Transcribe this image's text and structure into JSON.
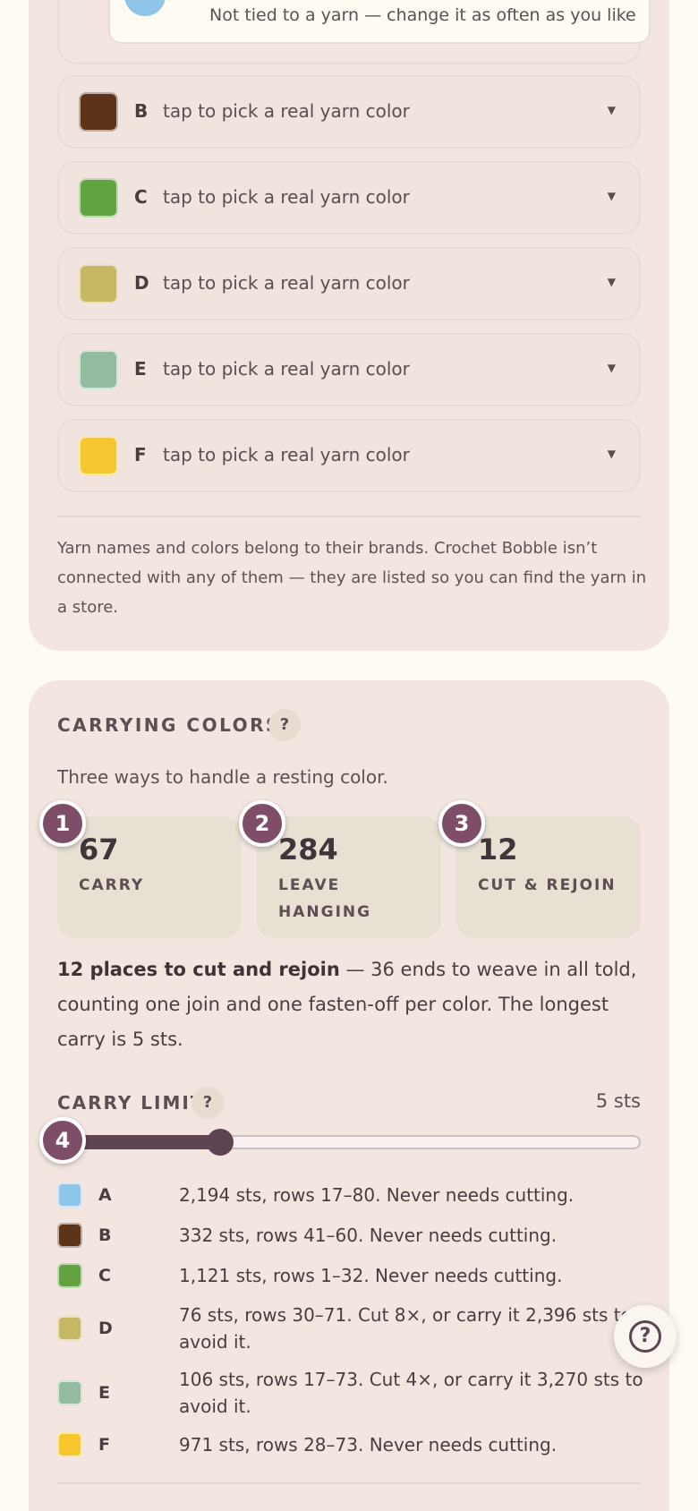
{
  "palette": {
    "tip": "Not tied to a yarn — change it as often as you like",
    "tip_color": "#8ec5e9",
    "yarns": [
      {
        "letter": "B",
        "hint": "tap to pick a real yarn color",
        "color": "#5e3418"
      },
      {
        "letter": "C",
        "hint": "tap to pick a real yarn color",
        "color": "#62a241"
      },
      {
        "letter": "D",
        "hint": "tap to pick a real yarn color",
        "color": "#c5b764"
      },
      {
        "letter": "E",
        "hint": "tap to pick a real yarn color",
        "color": "#93bba0"
      },
      {
        "letter": "F",
        "hint": "tap to pick a real yarn color",
        "color": "#f5c62e"
      }
    ],
    "caret": "▼",
    "disclaimer": "Yarn names and colors belong to their brands. Crochet Bobble isn’t connected with any of them — they are listed so you can find the yarn in a store."
  },
  "carrying": {
    "title": "CARRYING COLORS",
    "help": "?",
    "subtitle": "Three ways to handle a resting color.",
    "stats": [
      {
        "badge": "1",
        "value": "67",
        "label": "CARRY"
      },
      {
        "badge": "2",
        "value": "284",
        "label": "LEAVE HANGING"
      },
      {
        "badge": "3",
        "value": "12",
        "label": "CUT & REJOIN"
      }
    ],
    "summary_bold": "12 places to cut and rejoin",
    "summary_rest": " — 36 ends to weave in all told, counting one join and one fasten-off per color. The longest carry is 5 sts.",
    "limit_label": "CARRY LIMIT",
    "limit_help": "?",
    "limit_value": "5 sts",
    "limit_badge": "4",
    "limit_fraction": 0.27,
    "legend": [
      {
        "letter": "A",
        "text": "2,194 sts, rows 17–80. Never needs cutting.",
        "color": "#8ec5e9"
      },
      {
        "letter": "B",
        "text": "332 sts, rows 41–60. Never needs cutting.",
        "color": "#5e3418"
      },
      {
        "letter": "C",
        "text": "1,121 sts, rows 1–32. Never needs cutting.",
        "color": "#62a241"
      },
      {
        "letter": "D",
        "text": "76 sts, rows 30–71. Cut 8×, or carry it 2,396 sts to avoid it.",
        "color": "#c5b764"
      },
      {
        "letter": "E",
        "text": "106 sts, rows 17–73. Cut 4×, or carry it 3,270 sts to avoid it.",
        "color": "#93bba0"
      },
      {
        "letter": "F",
        "text": "971 sts, rows 28–73. Never needs cutting.",
        "color": "#f5c62e"
      }
    ]
  },
  "fab": {
    "icon": "question-circle-icon",
    "glyph": "?"
  }
}
